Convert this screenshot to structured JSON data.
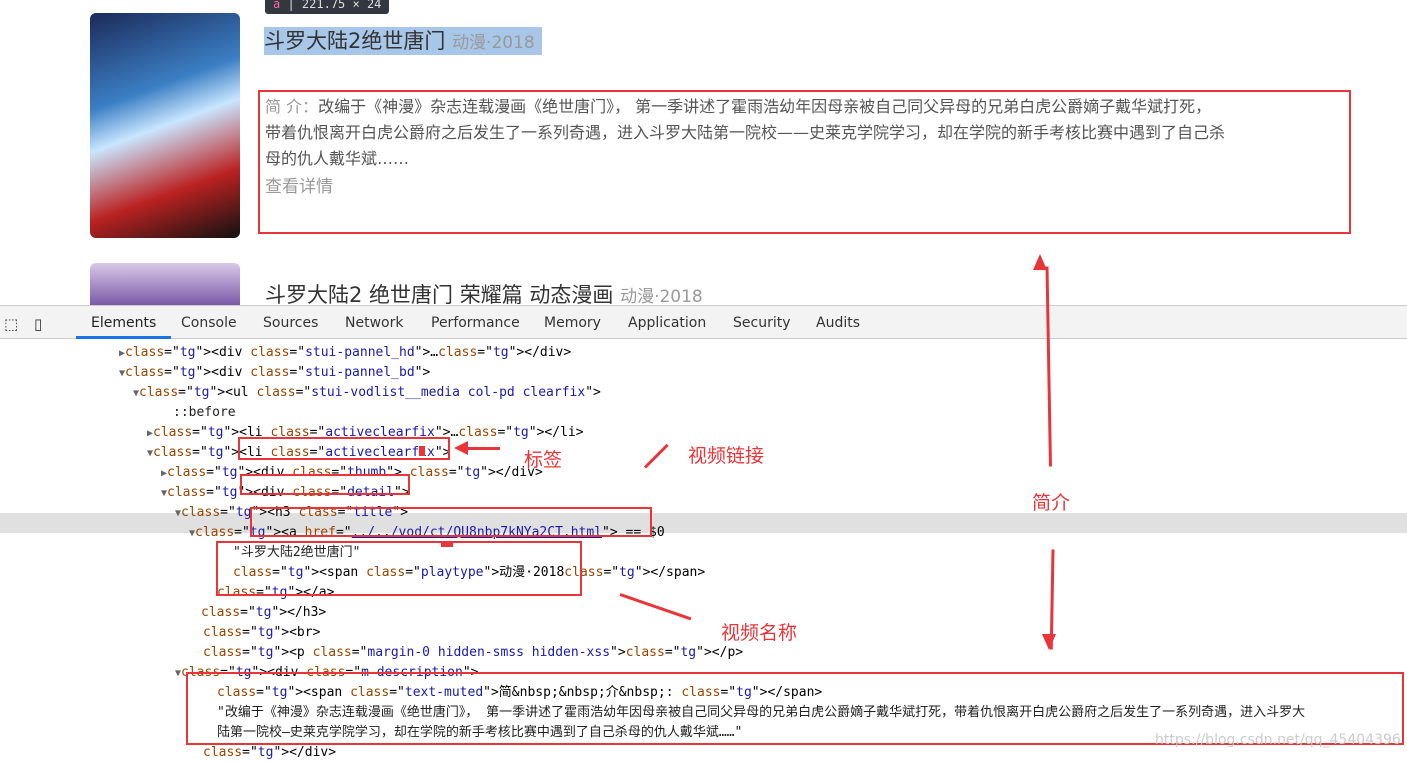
{
  "inspector_tooltip": {
    "tag": "a",
    "size": "221.75 × 24"
  },
  "item1": {
    "title": "斗罗大陆2绝世唐门",
    "playtype": "动漫·2018",
    "desc_label": "简  介：",
    "desc_lines": [
      "改编于《神漫》杂志连载漫画《绝世唐门》， 第一季讲述了霍雨浩幼年因母亲被自己同父异母的兄弟白虎公爵嫡子戴华斌打死，",
      "带着仇恨离开白虎公爵府之后发生了一系列奇遇，进入斗罗大陆第一院校——史莱克学院学习，却在学院的新手考核比赛中遇到了自己杀",
      "母的仇人戴华斌……"
    ],
    "more": "查看详情"
  },
  "item2": {
    "title": "斗罗大陆2 绝世唐门 荣耀篇 动态漫画",
    "playtype": "动漫·2018"
  },
  "devtools": {
    "tabs": [
      "Elements",
      "Console",
      "Sources",
      "Network",
      "Performance",
      "Memory",
      "Application",
      "Security",
      "Audits"
    ],
    "active_tab": "Elements"
  },
  "dom": [
    {
      "t": "<div class=\"stui-pannel_hd\">…</div>"
    },
    {
      "t": "<div class=\"stui-pannel_bd\">"
    },
    {
      "t": "<ul class=\"stui-vodlist__media col-pd clearfix\">"
    },
    {
      "t": "::before"
    },
    {
      "t": "<li class=\"activeclearfix\">…</li>"
    },
    {
      "t": "<li class=\"activeclearfix\">"
    },
    {
      "t": "<div class=\"thumb\">…</div>"
    },
    {
      "t": "<div class=\"detail\">"
    },
    {
      "t": "<h3 class=\"title\">"
    },
    {
      "t": "<a href=\"../../vod/ct/QU8nbp7kNYa2CT.html\"> == $0"
    },
    {
      "t": "\"斗罗大陆2绝世唐门\""
    },
    {
      "t": "<span class=\"playtype\">动漫·2018</span>"
    },
    {
      "t": "</a>"
    },
    {
      "t": "</h3>"
    },
    {
      "t": "<br>"
    },
    {
      "t": "<p class=\"margin-0 hidden-smss hidden-xss\"></p>"
    },
    {
      "t": "<div class=\"m-description\">"
    },
    {
      "t": "<span class=\"text-muted\">简&nbsp;&nbsp;介&nbsp;: </span>"
    },
    {
      "t": "\"改编于《神漫》杂志连载漫画《绝世唐门》， 第一季讲述了霍雨浩幼年因母亲被自己同父异母的兄弟白虎公爵嫡子戴华斌打死，带着仇恨离开白虎公爵府之后发生了一系列奇遇，进入斗罗大"
    },
    {
      "t": "陆第一院校—史莱克学院学习，却在学院的新手考核比赛中遇到了自己杀母的仇人戴华斌……\""
    },
    {
      "t": "</div>"
    }
  ],
  "annotations": {
    "tag": "标签",
    "link": "视频链接",
    "intro": "简介",
    "name": "视频名称"
  },
  "watermark": "https://blog.csdn.net/qq_45404396",
  "accent": "#e8353a"
}
